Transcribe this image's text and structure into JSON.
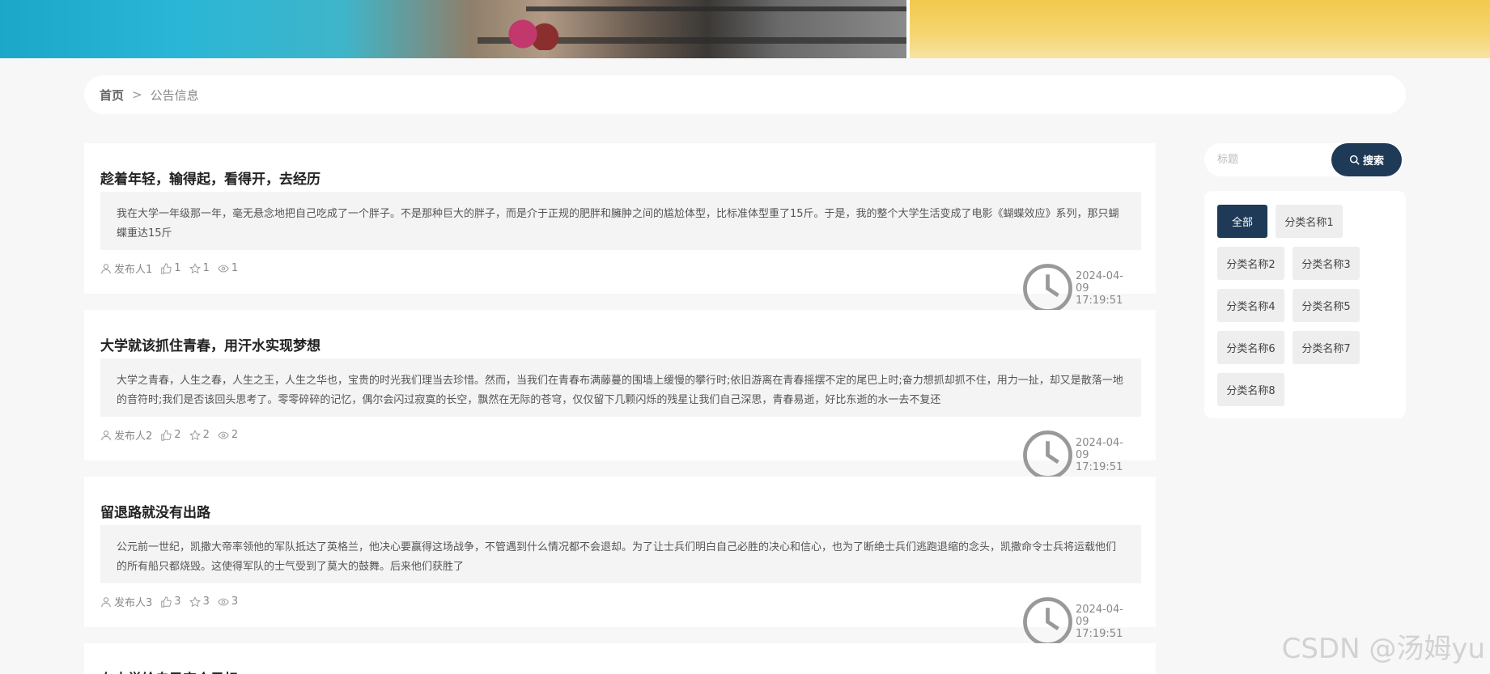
{
  "breadcrumb": {
    "home": "首页",
    "separator": ">",
    "current": "公告信息"
  },
  "articles": [
    {
      "title": "趁着年轻，输得起，看得开，去经历",
      "summary": "我在大学一年级那一年，毫无悬念地把自己吃成了一个胖子。不是那种巨大的胖子，而是介于正规的肥胖和臃肿之间的尴尬体型，比标准体型重了15斤。于是，我的整个大学生活变成了电影《蝴蝶效应》系列，那只蝴蝶重达15斤",
      "author": "发布人1",
      "likes": "1",
      "favorites": "1",
      "views": "1",
      "date": "2024-04-09 17:19:51"
    },
    {
      "title": "大学就该抓住青春，用汗水实现梦想",
      "summary": "大学之青春，人生之春，人生之王，人生之华也，宝贵的时光我们理当去珍惜。然而，当我们在青春布满藤蔓的围墙上缓慢的攀行时;依旧游离在青春摇摆不定的尾巴上时;奋力想抓却抓不住，用力一扯，却又是散落一地的音符时;我们是否该回头思考了。零零碎碎的记忆，偶尔会闪过寂寞的长空，飘然在无际的苍穹，仅仅留下几颗闪烁的残星让我们自己深思，青春易逝，好比东逝的水一去不复还",
      "author": "发布人2",
      "likes": "2",
      "favorites": "2",
      "views": "2",
      "date": "2024-04-09 17:19:51"
    },
    {
      "title": "留退路就没有出路",
      "summary": "公元前一世纪，凯撒大帝率领他的军队抵达了英格兰，他决心要赢得这场战争，不管遇到什么情况都不会退却。为了让士兵们明白自己必胜的决心和信心，也为了断绝士兵们逃跑退缩的念头，凯撒命令士兵将运载他们的所有船只都烧毁。这使得军队的士气受到了莫大的鼓舞。后来他们获胜了",
      "author": "发布人3",
      "likes": "3",
      "favorites": "3",
      "views": "3",
      "date": "2024-04-09 17:19:51"
    },
    {
      "title": "在大学给自己定个目标"
    }
  ],
  "search": {
    "placeholder": "标题",
    "button_label": "搜索"
  },
  "categories": [
    "全部",
    "分类名称1",
    "分类名称2",
    "分类名称3",
    "分类名称4",
    "分类名称5",
    "分类名称6",
    "分类名称7",
    "分类名称8"
  ],
  "watermark": "CSDN @汤姆yu",
  "colors": {
    "accent": "#1e3a57",
    "background": "#f7f7f7"
  }
}
